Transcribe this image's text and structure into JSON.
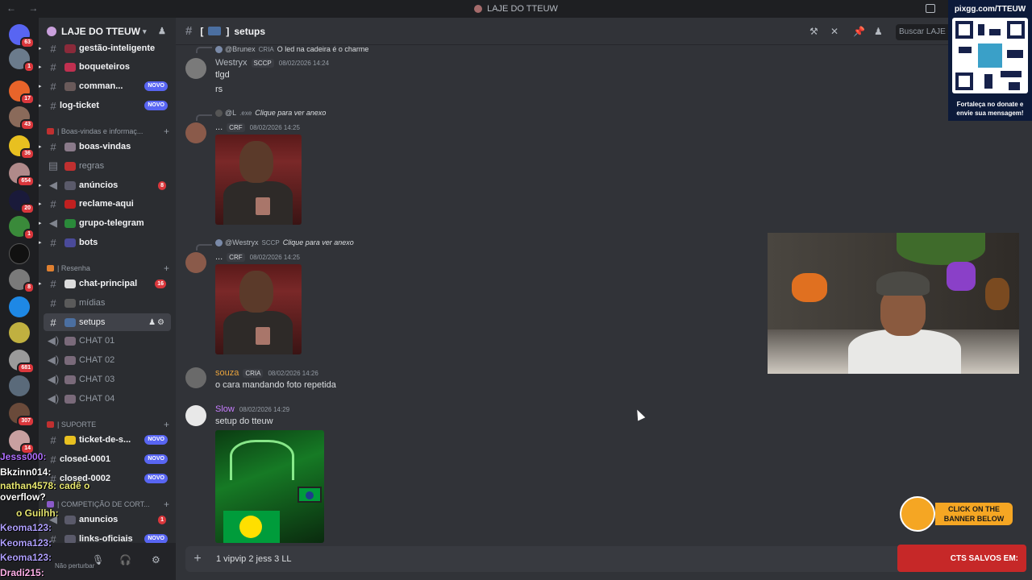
{
  "window": {
    "title": "LAJE DO TTEUW"
  },
  "guilds": [
    {
      "badge": "63"
    },
    {
      "badge": "1"
    },
    {
      "badge": "17"
    },
    {
      "badge": "43"
    },
    {
      "badge": "36"
    },
    {
      "badge": "654"
    },
    {
      "badge": "20"
    },
    {
      "badge": "1"
    },
    {
      "badge": ""
    },
    {
      "badge": "8"
    },
    {
      "badge": ""
    },
    {
      "badge": ""
    },
    {
      "badge": "681"
    },
    {
      "badge": ""
    },
    {
      "badge": "307"
    },
    {
      "badge": "14"
    }
  ],
  "server": {
    "name": "LAJE DO TTEUW"
  },
  "channels": {
    "gestao": "gestão-inteligente",
    "boqueteiros": "boqueteiros",
    "commands": "comman...",
    "logticket": "log-ticket",
    "cat_boas": "| Boas-vindas e informaç...",
    "boasvindas": "boas-vindas",
    "regras": "regras",
    "anuncios": "anúncios",
    "anuncios_count": "8",
    "reclame": "reclame-aqui",
    "telegram": "grupo-telegram",
    "bots": "bots",
    "cat_resenha": "| Resenha",
    "chatprincipal": "chat-principal",
    "chatprincipal_count": "16",
    "midias": "mídias",
    "setups": "setups",
    "chat01": "CHAT 01",
    "chat02": "CHAT 02",
    "chat03": "CHAT 03",
    "chat04": "CHAT 04",
    "cat_suporte": "| SUPORTE",
    "ticket": "ticket-de-s...",
    "closed1": "closed-0001",
    "closed2": "closed-0002",
    "cat_comp": "| COMPETIÇÃO DE CORT...",
    "anuncios2": "anuncios",
    "anuncios2_count": "1",
    "links": "links-oficiais",
    "new_label": "NOVO"
  },
  "user": {
    "status": "Não perturbar"
  },
  "header": {
    "channel": "setups",
    "search_placeholder": "Buscar LAJE DO"
  },
  "messages": [
    {
      "reply_user": "@Brunex",
      "reply_tag": "CRIA",
      "reply_text": "O led na cadeira é o charme",
      "author": "Westryx",
      "tag": "SCCP",
      "time": "08/02/2026 14:24",
      "lines": [
        "tlgd",
        "rs"
      ]
    },
    {
      "reply_user": "@L",
      "reply_tag": ".exe",
      "reply_text": "Clique para ver anexo",
      "author": "...",
      "tag": "CRF",
      "time": "08/02/2026 14:25"
    },
    {
      "reply_user": "@Westryx",
      "reply_tag": "SCCP",
      "reply_text": "Clique para ver anexo",
      "author": "...",
      "tag": "CRF",
      "time": "08/02/2026 14:25"
    },
    {
      "author": "souza",
      "tag": "CRIA",
      "time": "08/02/2026 14:26",
      "text": "o cara mandando foto repetida"
    },
    {
      "author": "Slow",
      "time": "08/02/2026 14:29",
      "text": "setup do tteuw"
    }
  ],
  "composer": {
    "value": "1 vipvip 2 jess 3 LL"
  },
  "overlay": {
    "qr_title": "pixgg.com/TTEUW",
    "qr_caption": "Fortaleça no donate e envie sua mensagem!",
    "banner": "CLICK ON THE BANNER BELOW",
    "cts": "CTS SALVOS EM:",
    "chat": [
      "Jesss000:",
      "Bkzinn014:",
      "nathan4578: cadê o",
      "overflow?",
      "o Guilhh:",
      "Keoma123:",
      "Keoma123:",
      "Keoma123:",
      "Dradi215:"
    ]
  },
  "colors": {
    "accent": "#5865f2",
    "mention": "#da373c",
    "westryx": "#b5bac1",
    "souza": "#e8a33d",
    "slow": "#c77dff"
  }
}
